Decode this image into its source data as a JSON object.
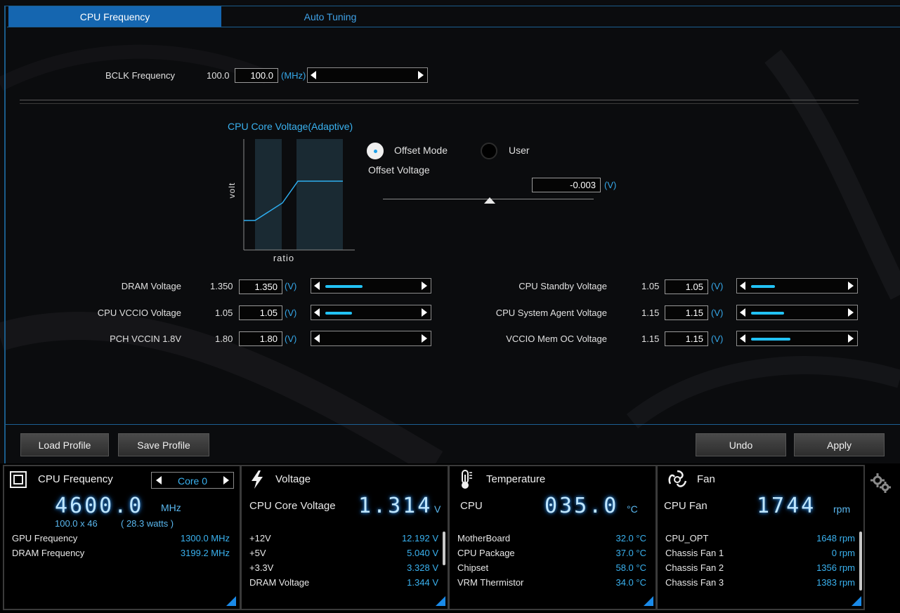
{
  "tabs": [
    {
      "label": "CPU Frequency",
      "active": true
    },
    {
      "label": "Auto Tuning",
      "active": false
    }
  ],
  "bclk": {
    "label": "BCLK Frequency",
    "current": "100.0",
    "value": "100.0",
    "unit": "(MHz)"
  },
  "graph": {
    "title": "CPU Core Voltage(Adaptive)",
    "ylabel": "volt",
    "xlabel": "ratio"
  },
  "mode": {
    "options": [
      {
        "label": "Offset Mode",
        "selected": true
      },
      {
        "label": "User",
        "selected": false
      }
    ],
    "offset_label": "Offset Voltage",
    "offset_value": "-0.003",
    "offset_unit": "(V)",
    "offset_slider_level": 0.5
  },
  "left_voltages": [
    {
      "label": "DRAM Voltage",
      "current": "1.350",
      "value": "1.350",
      "unit": "(V)",
      "level": 0.38
    },
    {
      "label": "CPU VCCIO Voltage",
      "current": "1.05",
      "value": "1.05",
      "unit": "(V)",
      "level": 0.27
    },
    {
      "label": "PCH VCCIN 1.8V",
      "current": "1.80",
      "value": "1.80",
      "unit": "(V)",
      "level": 0.0
    }
  ],
  "right_voltages": [
    {
      "label": "CPU Standby Voltage",
      "current": "1.05",
      "value": "1.05",
      "unit": "(V)",
      "level": 0.24
    },
    {
      "label": "CPU System Agent Voltage",
      "current": "1.15",
      "value": "1.15",
      "unit": "(V)",
      "level": 0.33
    },
    {
      "label": "VCCIO Mem OC Voltage",
      "current": "1.15",
      "value": "1.15",
      "unit": "(V)",
      "level": 0.4
    }
  ],
  "actions": {
    "load_profile": "Load Profile",
    "save_profile": "Save Profile",
    "undo": "Undo",
    "apply": "Apply"
  },
  "monitor": {
    "cpu": {
      "title": "CPU Frequency",
      "core_select": "Core 0",
      "big_value": "4600.0",
      "big_unit": "MHz",
      "multiplier": "100.0  x  46",
      "power": "( 28.3  watts )",
      "rows": [
        {
          "label": "GPU Frequency",
          "value": "1300.0  MHz"
        },
        {
          "label": "DRAM Frequency",
          "value": "3199.2  MHz"
        }
      ]
    },
    "voltage": {
      "title": "Voltage",
      "main_label": "CPU Core Voltage",
      "big_value": "1.314",
      "big_unit": "V",
      "rows": [
        {
          "label": "+12V",
          "value": "12.192  V"
        },
        {
          "label": "+5V",
          "value": "5.040  V"
        },
        {
          "label": "+3.3V",
          "value": "3.328  V"
        },
        {
          "label": "DRAM Voltage",
          "value": "1.344  V"
        }
      ]
    },
    "temperature": {
      "title": "Temperature",
      "main_label": "CPU",
      "big_value": "035.0",
      "big_unit": "°C",
      "rows": [
        {
          "label": "MotherBoard",
          "value": "32.0 °C"
        },
        {
          "label": "CPU Package",
          "value": "37.0 °C"
        },
        {
          "label": "Chipset",
          "value": "58.0 °C"
        },
        {
          "label": "VRM Thermistor",
          "value": "34.0 °C"
        }
      ]
    },
    "fan": {
      "title": "Fan",
      "main_label": "CPU Fan",
      "big_value": "1744",
      "big_unit": "rpm",
      "rows": [
        {
          "label": "CPU_OPT",
          "value": "1648  rpm"
        },
        {
          "label": "Chassis Fan 1",
          "value": "0  rpm"
        },
        {
          "label": "Chassis Fan 2",
          "value": "1356  rpm"
        },
        {
          "label": "Chassis Fan 3",
          "value": "1383  rpm"
        }
      ]
    }
  }
}
